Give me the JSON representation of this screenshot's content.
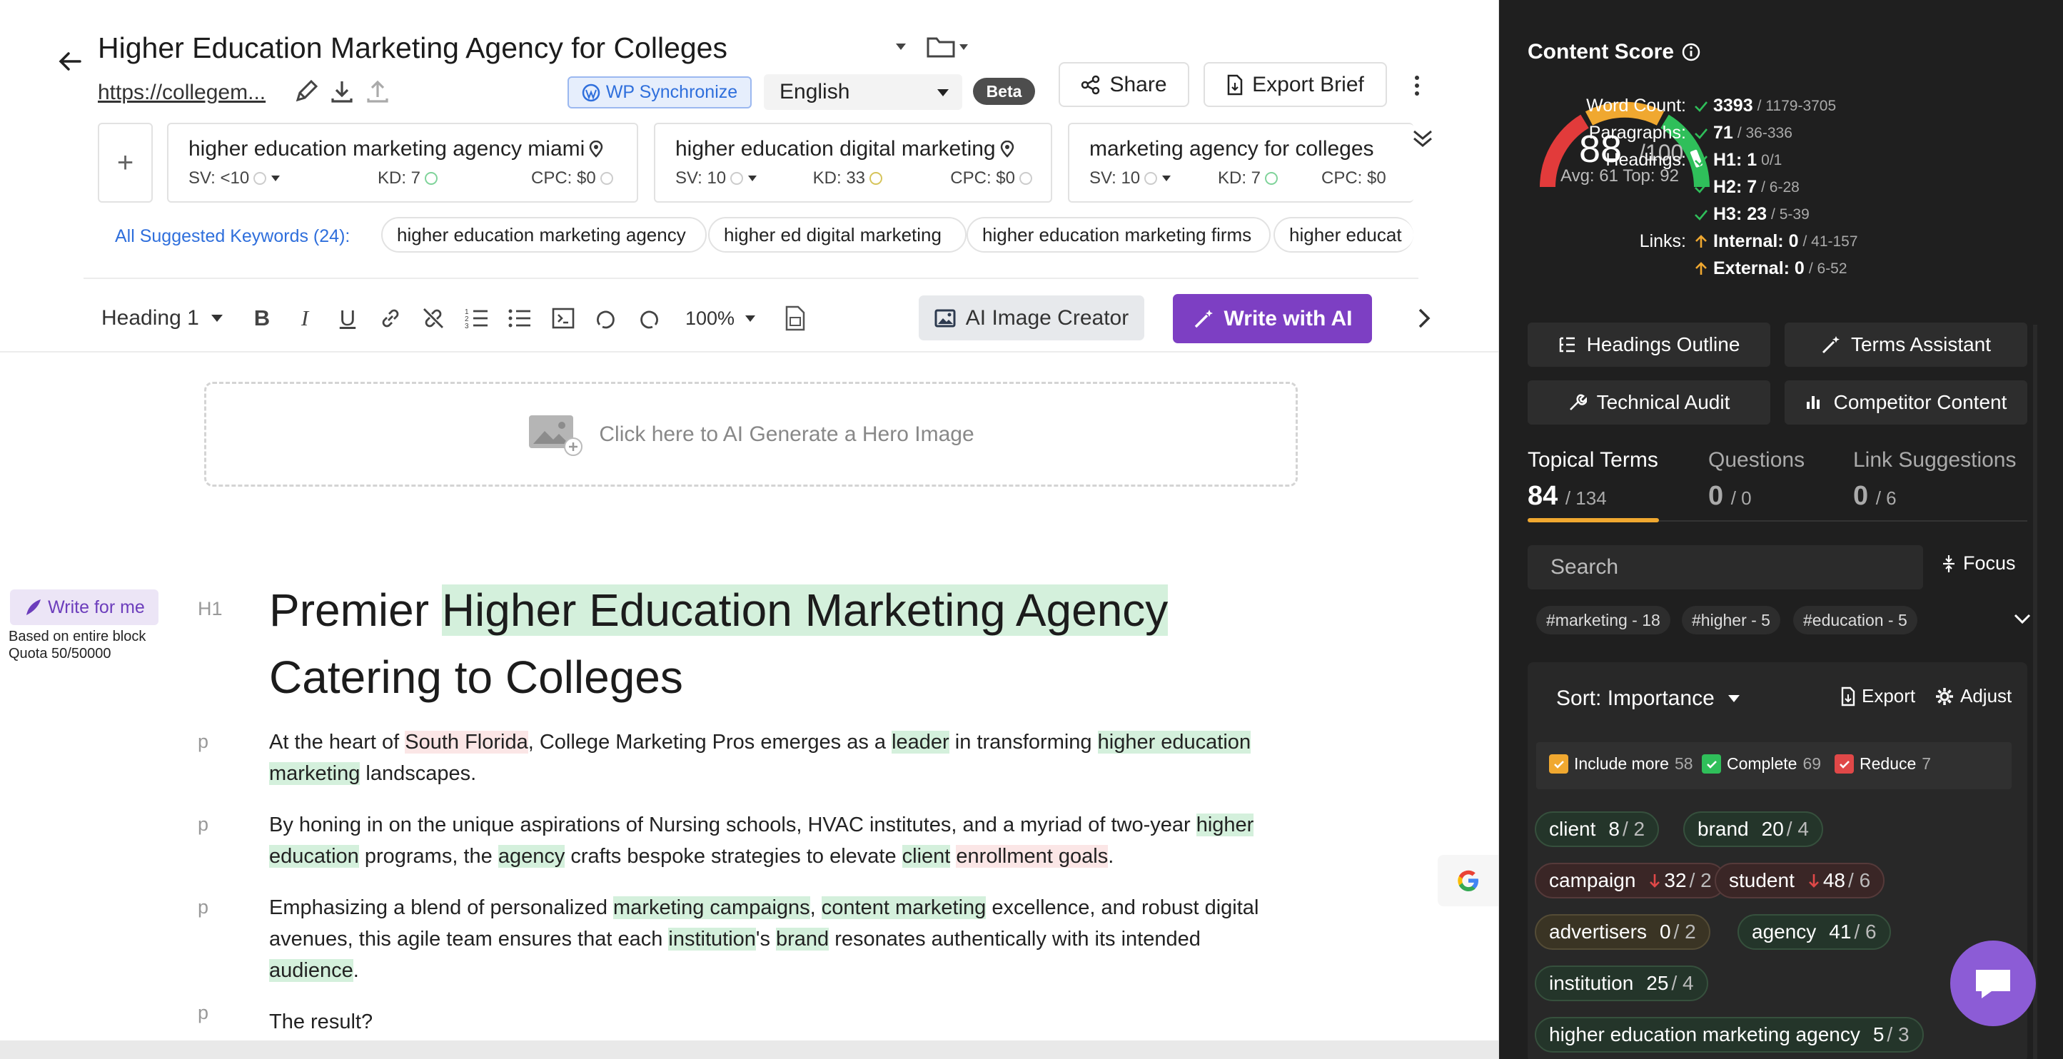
{
  "header": {
    "title": "Higher Education Marketing Agency for Colleges",
    "url": "https://collegem...",
    "wp_sync": "WP Synchronize",
    "language": "English",
    "beta": "Beta",
    "share": "Share",
    "export_brief": "Export Brief"
  },
  "keywords": [
    {
      "name": "higher education marketing agency miami",
      "sv": "SV: <10",
      "kd": "KD: 7",
      "cpc": "CPC: $0"
    },
    {
      "name": "higher education digital marketing",
      "sv": "SV: 10",
      "kd": "KD: 33",
      "cpc": "CPC: $0"
    },
    {
      "name": "marketing agency for colleges",
      "sv": "SV: 10",
      "kd": "KD: 7",
      "cpc": "CPC: $0"
    }
  ],
  "suggested": {
    "label": "All Suggested Keywords (24):",
    "chips": [
      "higher education marketing agency",
      "higher ed digital marketing",
      "higher education marketing firms",
      "higher educat"
    ]
  },
  "toolbar": {
    "heading": "Heading 1",
    "zoom": "100%",
    "ai_image": "AI Image Creator",
    "write_ai": "Write with AI"
  },
  "hero": {
    "label": "Click here to AI Generate a Hero Image"
  },
  "write_for_me": {
    "label": "Write for me",
    "note1": "Based on entire block",
    "note2": "Quota 50/50000"
  },
  "content": {
    "h1_tag": "H1",
    "p_tag": "p",
    "h1_a": "Premier ",
    "h1_b": "Higher Education Marketing Agency",
    "h1_c": "Catering to Colleges",
    "p1": [
      "At the heart of ",
      "South Florida",
      ", College Marketing Pros emerges as a ",
      "leader",
      " in transforming ",
      "higher education marketing",
      " landscapes."
    ],
    "p2": [
      "By honing in on the unique aspirations of Nursing schools, HVAC institutes, and a myriad of two-year ",
      "higher education",
      " programs, the ",
      "agency",
      " crafts bespoke strategies to elevate ",
      "client",
      " ",
      "enrollment goals",
      "."
    ],
    "p3": [
      "Emphasizing a blend of personalized ",
      "marketing campaigns",
      ", ",
      "content marketing",
      " excellence, and robust digital avenues, this agile team ensures that each ",
      "institution",
      "'s ",
      "brand",
      " resonates authentically with its intended ",
      "audience",
      "."
    ],
    "p4": "The result?"
  },
  "score": {
    "title": "Content Score",
    "value": "88",
    "max": "/100",
    "avg_top": "Avg: 61 Top: 92",
    "value_pct": 88,
    "stats": [
      {
        "label": "Word Count:",
        "value": "3393",
        "range": "/ 1179-3705",
        "status": "ok"
      },
      {
        "label": "Paragraphs:",
        "value": "71",
        "range": "/ 36-336",
        "status": "ok"
      },
      {
        "label": "Headings:",
        "value": "H1: 1",
        "range": "0/1",
        "status": "ok"
      },
      {
        "label": "",
        "value": "H2: 7",
        "range": "/ 6-28",
        "status": "ok"
      },
      {
        "label": "",
        "value": "H3: 23",
        "range": "/ 5-39",
        "status": "ok"
      },
      {
        "label": "Links:",
        "value": "Internal: 0",
        "range": "/ 41-157",
        "status": "up"
      },
      {
        "label": "",
        "value": "External: 0",
        "range": "/ 6-52",
        "status": "up"
      }
    ]
  },
  "panel_buttons": {
    "headings_outline": "Headings Outline",
    "terms_assistant": "Terms Assistant",
    "technical_audit": "Technical Audit",
    "competitor_content": "Competitor Content"
  },
  "tabs": [
    {
      "label": "Topical Terms",
      "count": "84",
      "total": "/ 134"
    },
    {
      "label": "Questions",
      "count": "0",
      "total": "/ 0"
    },
    {
      "label": "Link Suggestions",
      "count": "0",
      "total": "/ 6"
    }
  ],
  "search": {
    "placeholder": "Search",
    "focus": "Focus"
  },
  "tags": [
    "#marketing - 18",
    "#higher - 5",
    "#education - 5"
  ],
  "sort": {
    "label": "Sort: Importance",
    "export": "Export",
    "adjust": "Adjust"
  },
  "filters": [
    {
      "label": "Include more",
      "count": "58",
      "color": "#f0a830"
    },
    {
      "label": "Complete",
      "count": "69",
      "color": "#2fbf5a"
    },
    {
      "label": "Reduce",
      "count": "7",
      "color": "#e04848"
    }
  ],
  "terms": [
    {
      "name": "client",
      "cur": "8",
      "max": "/ 2",
      "kind": "g",
      "down": false
    },
    {
      "name": "brand",
      "cur": "20",
      "max": "/ 4",
      "kind": "g",
      "down": false
    },
    {
      "name": "campaign",
      "cur": "32",
      "max": "/ 2",
      "kind": "r",
      "down": true
    },
    {
      "name": "student",
      "cur": "48",
      "max": "/ 6",
      "kind": "r",
      "down": true
    },
    {
      "name": "advertisers",
      "cur": "0",
      "max": "/ 2",
      "kind": "y",
      "down": false
    },
    {
      "name": "agency",
      "cur": "41",
      "max": "/ 6",
      "kind": "g",
      "down": false
    },
    {
      "name": "institution",
      "cur": "25",
      "max": "/ 4",
      "kind": "g",
      "down": false
    },
    {
      "name": "higher education marketing agency",
      "cur": "5",
      "max": "/ 3",
      "kind": "g",
      "down": false
    }
  ]
}
